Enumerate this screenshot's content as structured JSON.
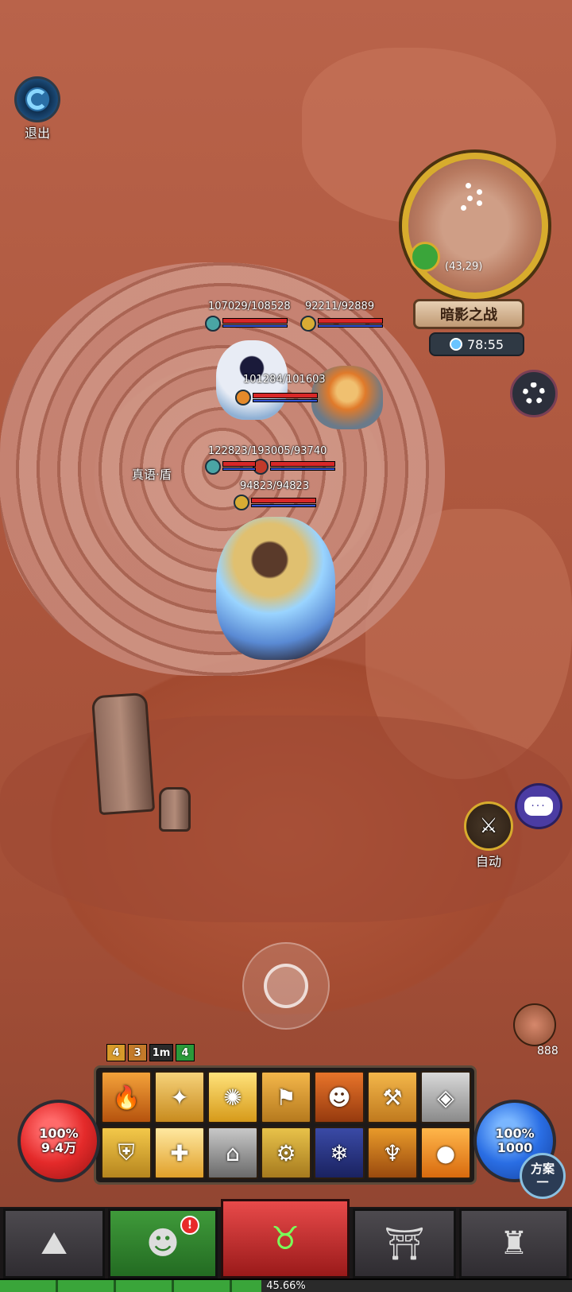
{
  "hud": {
    "exit_label": "退出",
    "settings_icon": "gear-icon",
    "auto_label": "自动",
    "chat_icon": "chat-icon",
    "plan_label_line1": "方案",
    "plan_label_line2": "一"
  },
  "minimap": {
    "coords": "(43,29)",
    "map_name": "暗影之战",
    "timer": "78:55"
  },
  "units": [
    {
      "hp": "107029/108528"
    },
    {
      "hp": "92211/92889"
    },
    {
      "hp": "101284/101603"
    },
    {
      "hp": "122823/193005/93740"
    },
    {
      "hp": "94823/94823"
    }
  ],
  "buff_label": "真语·盾",
  "meat_count": "888",
  "buff_row": [
    "4",
    "3",
    "1m",
    "4"
  ],
  "skills": [
    {
      "icon": "fire-spirit-icon",
      "glyph": "🔥"
    },
    {
      "icon": "wings-icon",
      "glyph": "✦"
    },
    {
      "icon": "light-burst-icon",
      "glyph": "✺"
    },
    {
      "icon": "banner-icon",
      "glyph": "⚑"
    },
    {
      "icon": "gingerbread-icon",
      "glyph": "☻"
    },
    {
      "icon": "hammer-icon",
      "glyph": "⚒"
    },
    {
      "icon": "shield-break-icon",
      "glyph": "◈"
    },
    {
      "icon": "holy-shield-icon",
      "glyph": "⛨"
    },
    {
      "icon": "holy-heal-icon",
      "glyph": "✚"
    },
    {
      "icon": "helmet-icon",
      "glyph": "⌂"
    },
    {
      "icon": "mech-icon",
      "glyph": "⚙"
    },
    {
      "icon": "frost-sigil-icon",
      "glyph": "❄"
    },
    {
      "icon": "angel-icon",
      "glyph": "♆"
    },
    {
      "icon": "golden-orb-icon",
      "glyph": "●"
    }
  ],
  "orbs": {
    "hp_percent": "100%",
    "hp_value": "9.4万",
    "mp_percent": "100%",
    "mp_value": "1000"
  },
  "nav": {
    "tab1_icon": "rock-icon",
    "tab2_icon": "hooded-hero-icon",
    "tab2_alert": "!",
    "tab3_icon": "demon-head-icon",
    "tab4_icon": "gate-icon",
    "tab5_icon": "castle-icon"
  },
  "xp": {
    "label": "45.66%",
    "value": 45.66
  },
  "colors": {
    "hp": "#d82828",
    "mp": "#3656d8",
    "gold": "#d7ac2d"
  }
}
